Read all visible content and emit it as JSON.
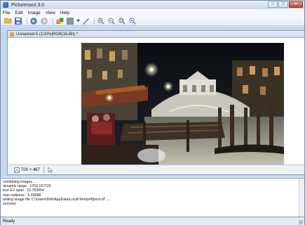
{
  "window": {
    "title": "Picturenaut 3.0",
    "minimize": "–",
    "maximize": "□",
    "close": "✕"
  },
  "menu": [
    "File",
    "Edit",
    "Image",
    "View",
    "Help"
  ],
  "toolbar": {
    "icons": [
      "open-folder-icon",
      "save-icon",
      "undo-icon",
      "redo-icon",
      "hdr-merge-icon",
      "tonemap-icon",
      "dropdown-arrow-icon",
      "brush-icon",
      "zoom-in-icon",
      "zoom-out-icon",
      "zoom-fit-icon",
      "zoom-actual-icon"
    ]
  },
  "document": {
    "tab_title": "Unnamed-5 (100%|RGB|16-Bit) *",
    "dimensions": "700 × 467"
  },
  "log": {
    "lines": [
      "combining images ...",
      "dynamic range : 1763.167725",
      "true EV span : 10.783954",
      "max radiance : 5.03588",
      "writing image file 'C:\\Users\\Dirk\\AppData\\Local\\Temp\\#8picm.tif' ...",
      "success"
    ]
  },
  "status": {
    "text": "Ready"
  },
  "colors": {
    "frame": "#d7e4f2",
    "mdi": "#c7d7ea",
    "accent": "#2c5aa0"
  }
}
